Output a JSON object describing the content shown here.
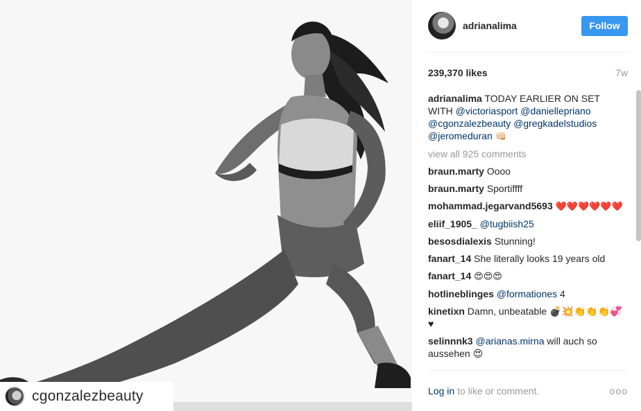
{
  "photo": {
    "watermark_username": "cgonzalezbeauty"
  },
  "header": {
    "username": "adrianalima",
    "follow_label": "Follow"
  },
  "stats": {
    "likes": "239,370 likes",
    "time": "7w"
  },
  "caption": {
    "user": "adrianalima",
    "text": " TODAY EARLIER ON SET WITH ",
    "mentions": [
      "@victoriasport",
      "@daniellepriano",
      "@cgonzalezbeauty",
      "@gregkadelstudios",
      "@jeromeduran"
    ],
    "emoji": "👊🏻"
  },
  "view_all": "view all 925 comments",
  "comments": [
    {
      "user": "braun.marty",
      "text": "Oooo"
    },
    {
      "user": "braun.marty",
      "text": "Sportiffff"
    },
    {
      "user": "mohammad.jegarvand5693",
      "text": "❤️❤️❤️❤️❤️❤️"
    },
    {
      "user": "eliif_1905_",
      "mention": "@tugbiish25",
      "text": ""
    },
    {
      "user": "besosdialexis",
      "text": "Stunning!"
    },
    {
      "user": "fanart_14",
      "text": "She literally looks 19 years old"
    },
    {
      "user": "fanart_14",
      "text": "😍😍😍"
    },
    {
      "user": "hotlineblinges",
      "mention": "@formationes",
      "text": " 4"
    },
    {
      "user": "kinetixn",
      "text": "Damn, unbeatable 💣💥👏👏👏💞♥"
    },
    {
      "user": "selinnnk3",
      "mention": "@arianas.mirna",
      "text": " will auch so aussehen 😍"
    }
  ],
  "footer": {
    "login_label": "Log in",
    "text": " to like or comment.",
    "more_label": "ooo"
  }
}
